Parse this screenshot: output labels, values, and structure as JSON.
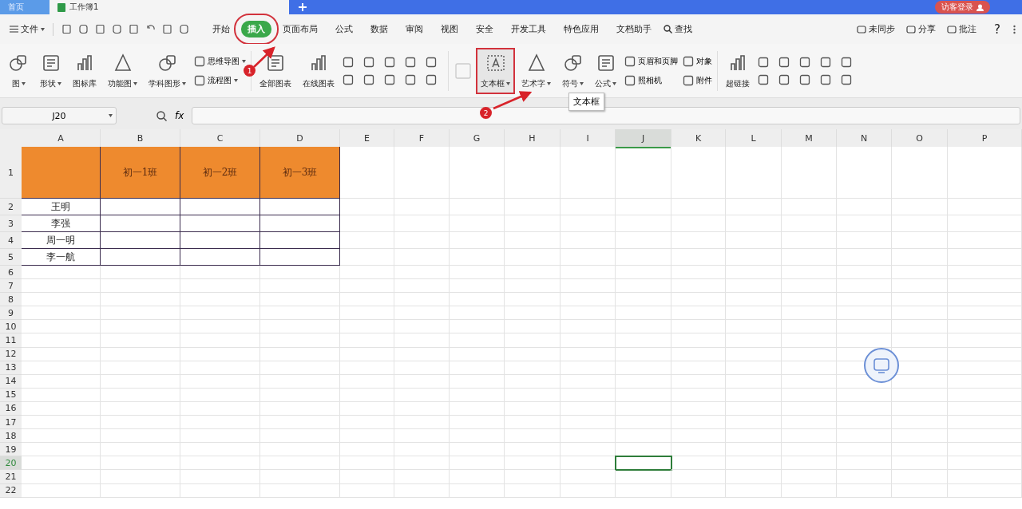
{
  "title_bar": {
    "tabs": [
      {
        "label": "首页",
        "selected": false
      },
      {
        "label": "工作簿1",
        "selected": true
      }
    ],
    "account": "访客登录"
  },
  "menu": {
    "file": "文件",
    "tabs": [
      {
        "label": "开始",
        "selected": false,
        "highlighted": false
      },
      {
        "label": "插入",
        "selected": true,
        "highlighted": true
      },
      {
        "label": "页面布局",
        "selected": false,
        "highlighted": false
      },
      {
        "label": "公式",
        "selected": false,
        "highlighted": false
      },
      {
        "label": "数据",
        "selected": false,
        "highlighted": false
      },
      {
        "label": "审阅",
        "selected": false,
        "highlighted": false
      },
      {
        "label": "视图",
        "selected": false,
        "highlighted": false
      },
      {
        "label": "安全",
        "selected": false,
        "highlighted": false
      },
      {
        "label": "开发工具",
        "selected": false,
        "highlighted": false
      },
      {
        "label": "特色应用",
        "selected": false,
        "highlighted": false
      },
      {
        "label": "文档助手",
        "selected": false,
        "highlighted": false
      }
    ],
    "find": "查找",
    "actions": [
      "未同步",
      "分享",
      "批注"
    ],
    "help": "?"
  },
  "ribbon": [
    {
      "kind": "large",
      "label": "图",
      "dropdown": true,
      "highlighted": false
    },
    {
      "kind": "large",
      "label": "形状",
      "dropdown": true,
      "highlighted": false
    },
    {
      "kind": "large",
      "label": "图标库",
      "dropdown": false,
      "highlighted": false
    },
    {
      "kind": "large",
      "label": "功能图",
      "dropdown": true,
      "highlighted": false
    },
    {
      "kind": "large",
      "label": "学科图形",
      "dropdown": true,
      "highlighted": false
    },
    {
      "kind": "stack",
      "items": [
        {
          "label": "思维导图",
          "dropdown": true
        },
        {
          "label": "流程图",
          "dropdown": true
        }
      ]
    },
    {
      "kind": "divider"
    },
    {
      "kind": "large",
      "label": "全部图表",
      "dropdown": false,
      "highlighted": false
    },
    {
      "kind": "large",
      "label": "在线图表",
      "dropdown": false,
      "highlighted": false
    },
    {
      "kind": "grid"
    },
    {
      "kind": "divider"
    },
    {
      "kind": "faded"
    },
    {
      "kind": "large",
      "label": "文本框",
      "dropdown": true,
      "highlighted": true,
      "tooltip": "文本框"
    },
    {
      "kind": "large",
      "label": "艺术字",
      "dropdown": true,
      "highlighted": false
    },
    {
      "kind": "large",
      "label": "符号",
      "dropdown": true,
      "highlighted": false
    },
    {
      "kind": "large",
      "label": "公式",
      "dropdown": true,
      "highlighted": false
    },
    {
      "kind": "stack",
      "items": [
        {
          "label": "页眉和页脚",
          "dropdown": false
        },
        {
          "label": "照相机",
          "dropdown": false
        }
      ]
    },
    {
      "kind": "stack",
      "items": [
        {
          "label": "对象",
          "dropdown": false
        },
        {
          "label": "附件",
          "dropdown": false
        }
      ]
    },
    {
      "kind": "divider"
    },
    {
      "kind": "large",
      "label": "超链接",
      "dropdown": false,
      "highlighted": false
    },
    {
      "kind": "grid"
    }
  ],
  "annotations": [
    "1",
    "2"
  ],
  "formula_bar": {
    "name_box": "J20",
    "fx": "fx"
  },
  "sheet": {
    "columns": [
      {
        "label": "A",
        "selected": false
      },
      {
        "label": "B",
        "selected": false
      },
      {
        "label": "C",
        "selected": false
      },
      {
        "label": "D",
        "selected": false
      },
      {
        "label": "E",
        "selected": false
      },
      {
        "label": "F",
        "selected": false
      },
      {
        "label": "G",
        "selected": false
      },
      {
        "label": "H",
        "selected": false
      },
      {
        "label": "I",
        "selected": false
      },
      {
        "label": "J",
        "selected": true
      },
      {
        "label": "K",
        "selected": false
      },
      {
        "label": "L",
        "selected": false
      },
      {
        "label": "M",
        "selected": false
      },
      {
        "label": "N",
        "selected": false
      },
      {
        "label": "O",
        "selected": false
      },
      {
        "label": "P",
        "selected": false
      }
    ],
    "rows": [
      {
        "label": "1",
        "selected": false
      },
      {
        "label": "2",
        "selected": false
      },
      {
        "label": "3",
        "selected": false
      },
      {
        "label": "4",
        "selected": false
      },
      {
        "label": "5",
        "selected": false
      },
      {
        "label": "6",
        "selected": false
      },
      {
        "label": "7",
        "selected": false
      },
      {
        "label": "8",
        "selected": false
      },
      {
        "label": "9",
        "selected": false
      },
      {
        "label": "10",
        "selected": false
      },
      {
        "label": "11",
        "selected": false
      },
      {
        "label": "12",
        "selected": false
      },
      {
        "label": "13",
        "selected": false
      },
      {
        "label": "14",
        "selected": false
      },
      {
        "label": "15",
        "selected": false
      },
      {
        "label": "16",
        "selected": false
      },
      {
        "label": "17",
        "selected": false
      },
      {
        "label": "18",
        "selected": false
      },
      {
        "label": "19",
        "selected": false
      },
      {
        "label": "20",
        "selected": true
      },
      {
        "label": "21",
        "selected": false
      },
      {
        "label": "22",
        "selected": false
      }
    ],
    "class_headers": [
      "初一1班",
      "初一2班",
      "初一3班"
    ],
    "names": [
      "王明",
      "李强",
      "周一明",
      "李一航"
    ]
  }
}
